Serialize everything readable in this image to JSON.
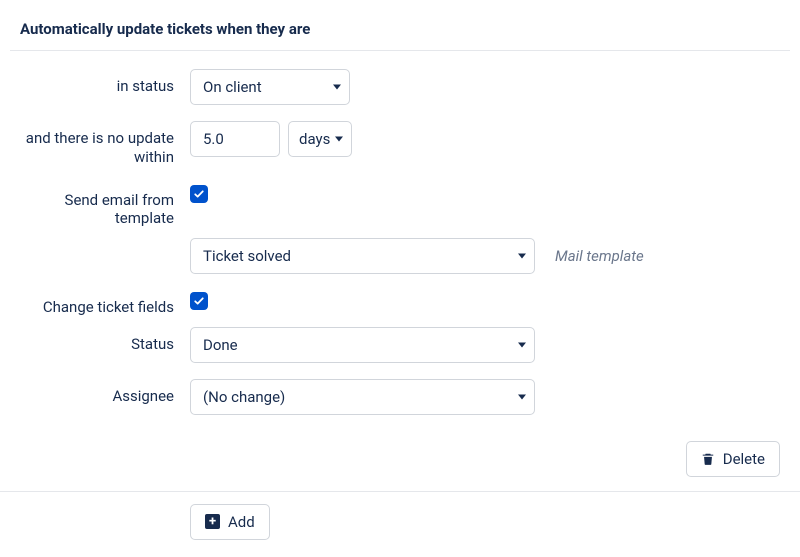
{
  "section": {
    "title": "Automatically update tickets when they are"
  },
  "labels": {
    "in_status": "in status",
    "no_update": "and there is no update within",
    "send_email": "Send email from template",
    "mail_template_hint": "Mail template",
    "change_fields": "Change ticket fields",
    "status": "Status",
    "assignee": "Assignee"
  },
  "values": {
    "status_filter": "On client",
    "duration_value": "5.0",
    "duration_unit": "days",
    "template_selected": "Ticket solved",
    "status_selected": "Done",
    "assignee_selected": "(No change)"
  },
  "buttons": {
    "delete": "Delete",
    "add": "Add"
  }
}
